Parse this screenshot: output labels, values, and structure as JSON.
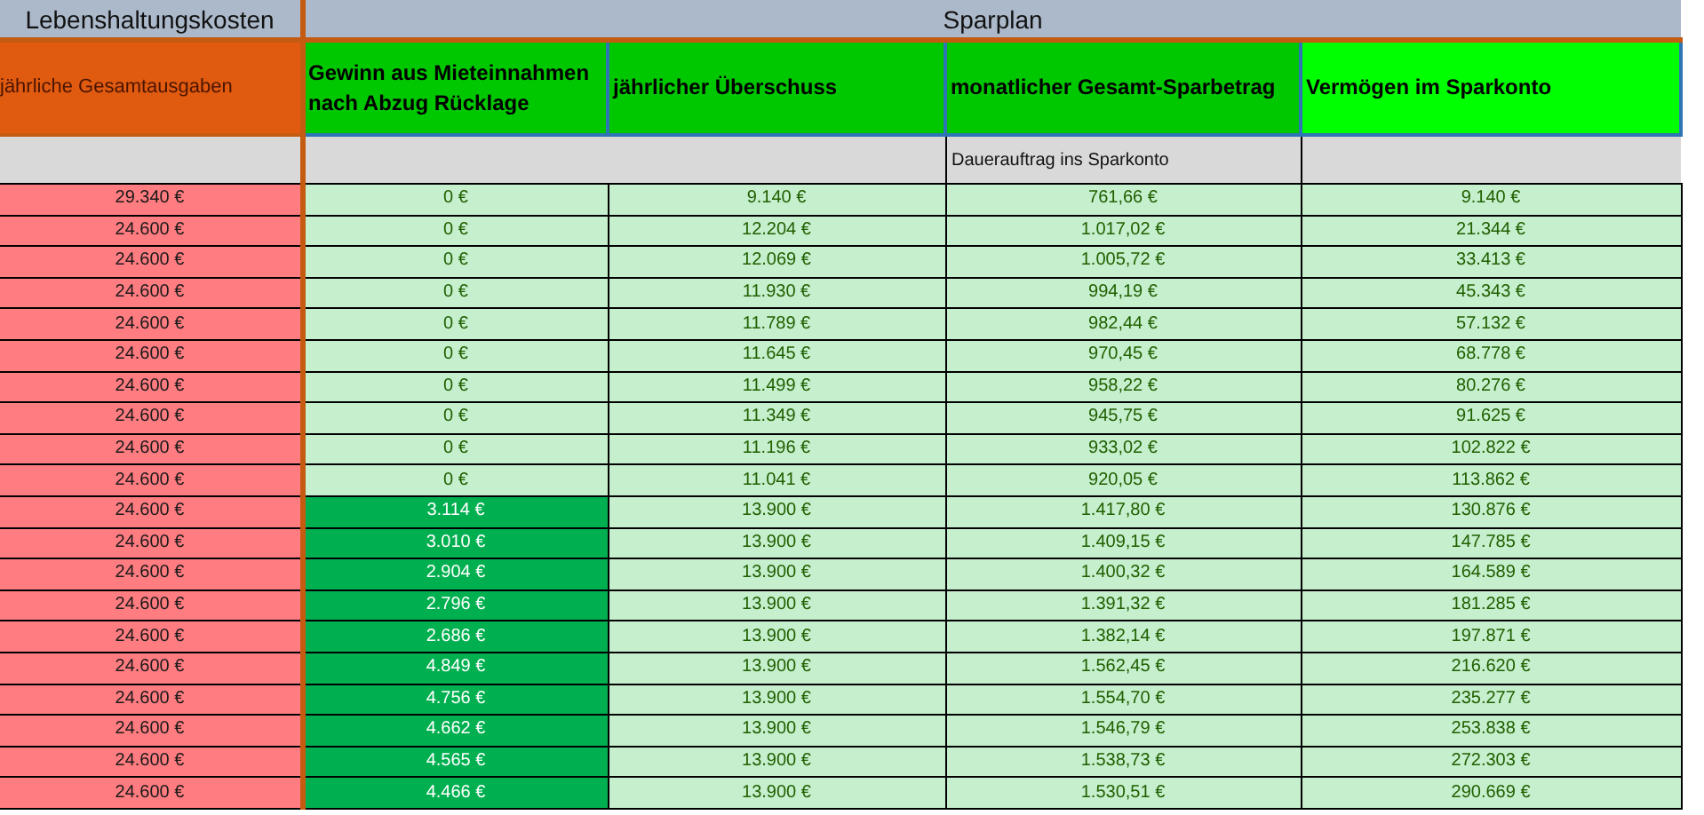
{
  "group_headers": [
    {
      "label": "Lebenshaltungskosten"
    },
    {
      "label": "Sparplan"
    }
  ],
  "columns": [
    {
      "label": "jährliche Gesamtausgaben",
      "color": "#e05a10"
    },
    {
      "label": "Gewinn aus Mieteinnahmen nach Abzug Rücklage",
      "color": "#00c800"
    },
    {
      "label": "jährlicher Überschuss",
      "color": "#00c800"
    },
    {
      "label": "monatlicher Gesamt-Sparbetrag",
      "color": "#00c800"
    },
    {
      "label": "Vermögen im Sparkonto",
      "color": "#00ff00"
    }
  ],
  "subheader_note": "Dauerauftrag ins Sparkonto",
  "rows": [
    {
      "cells": [
        "29.340 €",
        "0 €",
        "9.140 €",
        "761,66 €",
        "9.140 €"
      ],
      "gain_highlighted": false
    },
    {
      "cells": [
        "24.600 €",
        "0 €",
        "12.204 €",
        "1.017,02 €",
        "21.344 €"
      ],
      "gain_highlighted": false
    },
    {
      "cells": [
        "24.600 €",
        "0 €",
        "12.069 €",
        "1.005,72 €",
        "33.413 €"
      ],
      "gain_highlighted": false
    },
    {
      "cells": [
        "24.600 €",
        "0 €",
        "11.930 €",
        "994,19 €",
        "45.343 €"
      ],
      "gain_highlighted": false
    },
    {
      "cells": [
        "24.600 €",
        "0 €",
        "11.789 €",
        "982,44 €",
        "57.132 €"
      ],
      "gain_highlighted": false
    },
    {
      "cells": [
        "24.600 €",
        "0 €",
        "11.645 €",
        "970,45 €",
        "68.778 €"
      ],
      "gain_highlighted": false
    },
    {
      "cells": [
        "24.600 €",
        "0 €",
        "11.499 €",
        "958,22 €",
        "80.276 €"
      ],
      "gain_highlighted": false
    },
    {
      "cells": [
        "24.600 €",
        "0 €",
        "11.349 €",
        "945,75 €",
        "91.625 €"
      ],
      "gain_highlighted": false
    },
    {
      "cells": [
        "24.600 €",
        "0 €",
        "11.196 €",
        "933,02 €",
        "102.822 €"
      ],
      "gain_highlighted": false
    },
    {
      "cells": [
        "24.600 €",
        "0 €",
        "11.041 €",
        "920,05 €",
        "113.862 €"
      ],
      "gain_highlighted": false
    },
    {
      "cells": [
        "24.600 €",
        "3.114 €",
        "13.900 €",
        "1.417,80 €",
        "130.876 €"
      ],
      "gain_highlighted": true
    },
    {
      "cells": [
        "24.600 €",
        "3.010 €",
        "13.900 €",
        "1.409,15 €",
        "147.785 €"
      ],
      "gain_highlighted": true
    },
    {
      "cells": [
        "24.600 €",
        "2.904 €",
        "13.900 €",
        "1.400,32 €",
        "164.589 €"
      ],
      "gain_highlighted": true
    },
    {
      "cells": [
        "24.600 €",
        "2.796 €",
        "13.900 €",
        "1.391,32 €",
        "181.285 €"
      ],
      "gain_highlighted": true
    },
    {
      "cells": [
        "24.600 €",
        "2.686 €",
        "13.900 €",
        "1.382,14 €",
        "197.871 €"
      ],
      "gain_highlighted": true
    },
    {
      "cells": [
        "24.600 €",
        "4.849 €",
        "13.900 €",
        "1.562,45 €",
        "216.620 €"
      ],
      "gain_highlighted": true
    },
    {
      "cells": [
        "24.600 €",
        "4.756 €",
        "13.900 €",
        "1.554,70 €",
        "235.277 €"
      ],
      "gain_highlighted": true
    },
    {
      "cells": [
        "24.600 €",
        "4.662 €",
        "13.900 €",
        "1.546,79 €",
        "253.838 €"
      ],
      "gain_highlighted": true
    },
    {
      "cells": [
        "24.600 €",
        "4.565 €",
        "13.900 €",
        "1.538,73 €",
        "272.303 €"
      ],
      "gain_highlighted": true
    },
    {
      "cells": [
        "24.600 €",
        "4.466 €",
        "13.900 €",
        "1.530,51 €",
        "290.669 €"
      ],
      "gain_highlighted": true
    }
  ]
}
